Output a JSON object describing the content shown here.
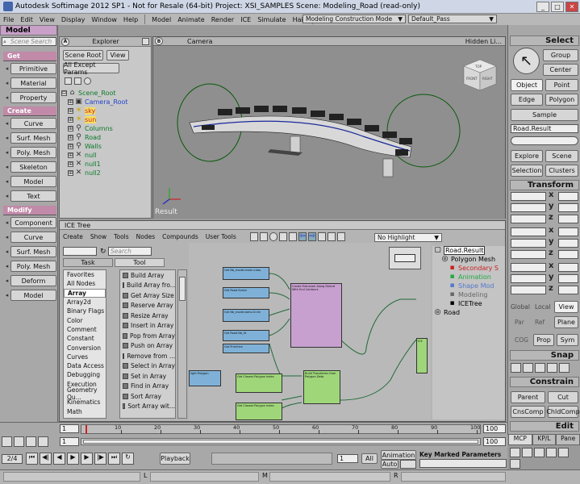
{
  "window": {
    "title": "Autodesk Softimage 2012 SP1   -  Not for Resale (64-bit)    Project: XSI_SAMPLES    Scene: Modeling_Road (read-only)",
    "minimize": "_",
    "maximize": "□",
    "close": "✕"
  },
  "menubar": {
    "items": [
      "File",
      "Edit",
      "View",
      "Display",
      "Window",
      "Help",
      "Model",
      "Animate",
      "Render",
      "ICE",
      "Simulate",
      "Hair",
      "Face Robot"
    ],
    "layout_dropdown": "Modeling Construction Mode",
    "pass_dropdown": "Default_Pass"
  },
  "left_panel": {
    "header": "Model",
    "search_placeholder": "Scene Search",
    "sections": {
      "get": "Get",
      "create": "Create",
      "modify": "Modify"
    },
    "get_buttons": [
      "Primitive",
      "Material",
      "Property"
    ],
    "create_buttons": [
      "Curve",
      "Surf. Mesh",
      "Poly. Mesh",
      "Skeleton",
      "Model",
      "Text"
    ],
    "modify_buttons": [
      "Component",
      "Curve",
      "Surf. Mesh",
      "Poly. Mesh",
      "Deform",
      "Model"
    ]
  },
  "explorer": {
    "label": "A",
    "title": "Explorer",
    "scope": "Scene Root",
    "view": "View",
    "filter": "All Except Params",
    "tree": [
      {
        "label": "Scene_Root",
        "color": "#0a7a2a",
        "indent": 0,
        "icon": "folder-icon",
        "expander": "⊟"
      },
      {
        "label": "Camera_Root",
        "color": "#2244cc",
        "indent": 1,
        "icon": "camera-icon",
        "expander": "⊞"
      },
      {
        "label": "sky",
        "color": "#cc2020",
        "indent": 1,
        "icon": "light-icon",
        "expander": "⊞"
      },
      {
        "label": "sun",
        "color": "#cc2020",
        "indent": 1,
        "icon": "light-icon",
        "expander": "⊞"
      },
      {
        "label": "Columns",
        "color": "#0a7a2a",
        "indent": 1,
        "icon": "model-icon",
        "expander": "⊞"
      },
      {
        "label": "Road",
        "color": "#0a7a2a",
        "indent": 1,
        "icon": "model-icon",
        "expander": "⊞"
      },
      {
        "label": "Walls",
        "color": "#0a7a2a",
        "indent": 1,
        "icon": "model-icon",
        "expander": "⊞"
      },
      {
        "label": "null",
        "color": "#0a7a2a",
        "indent": 1,
        "icon": "null-icon",
        "expander": "⊞"
      },
      {
        "label": "null1",
        "color": "#0a7a2a",
        "indent": 1,
        "icon": "null-icon",
        "expander": "⊞"
      },
      {
        "label": "null2",
        "color": "#0a7a2a",
        "indent": 1,
        "icon": "null-icon",
        "expander": "⊞"
      }
    ]
  },
  "viewport": {
    "label": "B",
    "camera": "Camera",
    "hidden": "Hidden Li...",
    "status": "Result",
    "cube_top": "TOP",
    "cube_front": "FRONT",
    "cube_right": "RIGHT"
  },
  "ice_tree": {
    "title": "ICE Tree",
    "menu": [
      "Create",
      "Show",
      "Tools",
      "Nodes",
      "Compounds",
      "User Tools"
    ],
    "highlight": "No Highlight",
    "search_placeholder": "Search",
    "tabs": [
      "Task",
      "Tool"
    ],
    "tasks": [
      "Favorites",
      "All Nodes",
      "Array",
      "Array2d",
      "Binary Flags",
      "Color",
      "Comment",
      "Constant",
      "Conversion",
      "Curves",
      "Data Access",
      "Debugging",
      "Execution",
      "Geometry Qu...",
      "Kinematics",
      "Math"
    ],
    "selected_task": "Array",
    "tools": [
      "Build Array",
      "Build Array fro...",
      "Get Array Size",
      "Reserve Array",
      "Resize Array",
      "Insert in Array",
      "Pop from Array",
      "Push on Array",
      "Remove from ...",
      "Select in Array",
      "Set in Array",
      "Find in Array",
      "Sort Array",
      "Sort Array wit..."
    ],
    "graph_nodes": [
      {
        "title": "Get Nb_model.mesh.class",
        "kind": "blue"
      },
      {
        "title": "Get Road.Scalar",
        "kind": "blue"
      },
      {
        "title": "Get Nb_model.data.Circle",
        "kind": "blue"
      },
      {
        "title": "Get Road.Nb_St",
        "kind": "blue"
      },
      {
        "title": "Create Extrusion Along Strand With End Contours",
        "kind": "purple"
      },
      {
        "title": "Get Primitive",
        "kind": "blue"
      },
      {
        "title": "Get Closest Polygon Index",
        "kind": "green"
      },
      {
        "title": "Get Closest Polygon Index",
        "kind": "green"
      },
      {
        "title": "Build Transforms from Polygon Data",
        "kind": "green"
      },
      {
        "title": "ICE",
        "kind": "green"
      },
      {
        "title": "light.Polygon",
        "kind": "blue"
      }
    ],
    "stack": [
      {
        "label": "Road.Result",
        "color": "#000",
        "indent": 0
      },
      {
        "label": "Polygon Mesh",
        "color": "#000",
        "indent": 1
      },
      {
        "label": "Secondary S",
        "color": "#cc2020",
        "indent": 2
      },
      {
        "label": "Animation",
        "color": "#22aa44",
        "indent": 2
      },
      {
        "label": "Shape Mod",
        "color": "#5577cc",
        "indent": 2
      },
      {
        "label": "Modeling",
        "color": "#666",
        "indent": 2
      },
      {
        "label": "ICETree",
        "color": "#000",
        "indent": 2
      },
      {
        "label": "Road",
        "color": "#000",
        "indent": 0
      }
    ]
  },
  "right_panel": {
    "select_header": "Select",
    "group": "Group",
    "center": "Center",
    "object": "Object",
    "point": "Point",
    "edge": "Edge",
    "polygon": "Polygon",
    "sample": "Sample",
    "selection_field": "Road.Result",
    "explore": "Explore",
    "scene": "Scene",
    "selection": "Selection",
    "clusters": "Clusters",
    "transform_header": "Transform",
    "transform_labels": [
      "x",
      "y",
      "z"
    ],
    "global": "Global",
    "local": "Local",
    "view": "View",
    "par": "Par",
    "ref": "Ref",
    "plane": "Plane",
    "cog": "COG",
    "prop": "Prop",
    "sym": "Sym",
    "snap_header": "Snap",
    "constrain_header": "Constrain",
    "parent": "Parent",
    "cut": "Cut",
    "cnscomp": "CnsComp",
    "chldcomp": "ChldComp",
    "edit_header": "Edit",
    "edit_tabs": [
      "MCP",
      "KP/L",
      "Pane"
    ]
  },
  "timeline": {
    "start": "1",
    "start2": "1",
    "end": "100",
    "end2": "100",
    "ticks": [
      "10",
      "20",
      "30",
      "40",
      "50",
      "60",
      "70",
      "80",
      "90",
      "100"
    ],
    "frame": "1",
    "all": "All",
    "playback": "Playback",
    "animation": "Animation",
    "auto": "Auto",
    "key_marked": "Key Marked Parameters",
    "fps": "2/4",
    "mouse_l": "L",
    "mouse_m": "M",
    "mouse_r": "R"
  },
  "colors": {
    "accent_purple": "#c8a0c8",
    "node_blue": "#7fb1d8",
    "node_green": "#9fd67a",
    "node_purple": "#c8a0d0"
  }
}
